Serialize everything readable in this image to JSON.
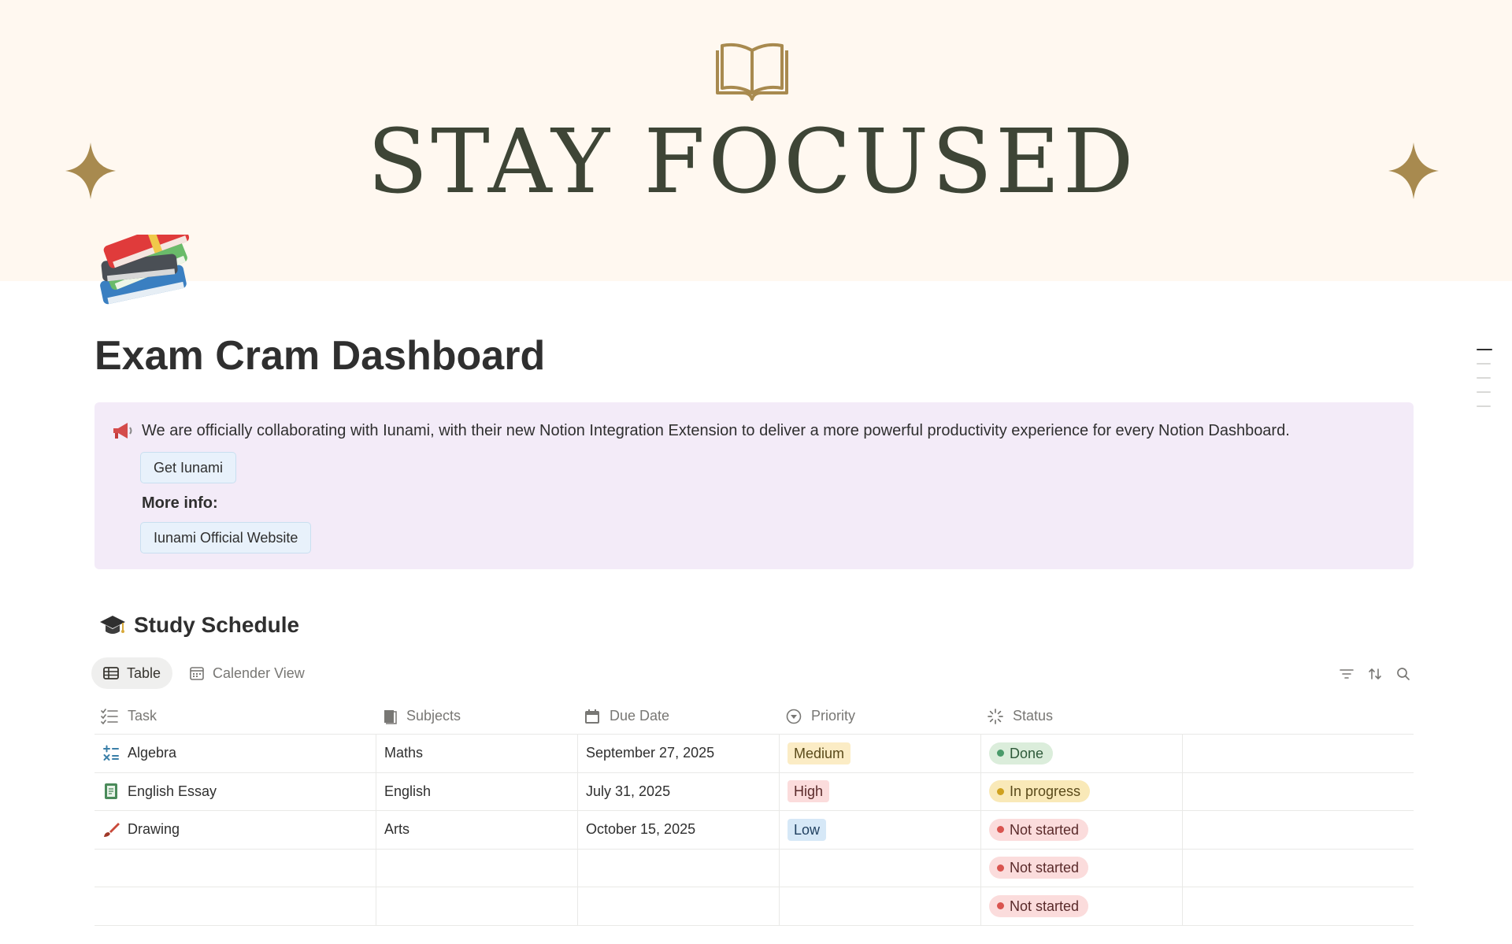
{
  "cover": {
    "title": "STAY FOCUSED",
    "icons": [
      "open-book-icon",
      "sparkle-icon"
    ],
    "colors": {
      "background": "#fff8f0",
      "title": "#3e4536",
      "accent": "#a88a4f"
    }
  },
  "page": {
    "icon": "books-icon",
    "title": "Exam Cram Dashboard"
  },
  "callout": {
    "icon": "megaphone-icon",
    "text": "We are officially collaborating with Iunami, with their new Notion Integration Extension to deliver a more powerful productivity experience for every Notion Dashboard.",
    "get_button": "Get Iunami",
    "more_info": "More info:",
    "website_button": "Iunami Official Website",
    "colors": {
      "background": "#f3ebf8",
      "button": "#e8f1fb"
    }
  },
  "schedule": {
    "icon": "graduation-cap-icon",
    "title": "Study Schedule",
    "tabs": [
      {
        "label": "Table",
        "icon": "table-icon",
        "active": true
      },
      {
        "label": "Calender View",
        "icon": "calendar-icon",
        "active": false
      }
    ],
    "toolbar": [
      "filter-icon",
      "sort-icon",
      "search-icon"
    ],
    "columns": [
      {
        "label": "Task",
        "icon": "checklist-icon"
      },
      {
        "label": "Subjects",
        "icon": "book-icon"
      },
      {
        "label": "Due Date",
        "icon": "calendar-icon"
      },
      {
        "label": "Priority",
        "icon": "priority-icon"
      },
      {
        "label": "Status",
        "icon": "status-icon"
      }
    ],
    "rows": [
      {
        "task": "Algebra",
        "task_icon": "math-icon",
        "subject": "Maths",
        "due": "September 27, 2025",
        "priority": "Medium",
        "status": "Done"
      },
      {
        "task": "English Essay",
        "task_icon": "notebook-icon",
        "subject": "English",
        "due": "July 31, 2025",
        "priority": "High",
        "status": "In progress"
      },
      {
        "task": "Drawing",
        "task_icon": "paintbrush-icon",
        "subject": "Arts",
        "due": "October 15, 2025",
        "priority": "Low",
        "status": "Not started"
      },
      {
        "task": "",
        "task_icon": "",
        "subject": "",
        "due": "",
        "priority": "",
        "status": "Not started"
      },
      {
        "task": "",
        "task_icon": "",
        "subject": "",
        "due": "",
        "priority": "",
        "status": "Not started"
      }
    ],
    "priority_colors": {
      "Medium": "#fbecc5",
      "High": "#fbdcdc",
      "Low": "#d6e8f7"
    },
    "status_colors": {
      "Done": {
        "bg": "#dbeddb",
        "dot": "#4a9a6a",
        "text": "#2f5a3a"
      },
      "In progress": {
        "bg": "#f9e9b8",
        "dot": "#cfa11f",
        "text": "#5a4a1a"
      },
      "Not started": {
        "bg": "#fbdcdc",
        "dot": "#d9544f",
        "text": "#5a2a2a"
      }
    }
  }
}
